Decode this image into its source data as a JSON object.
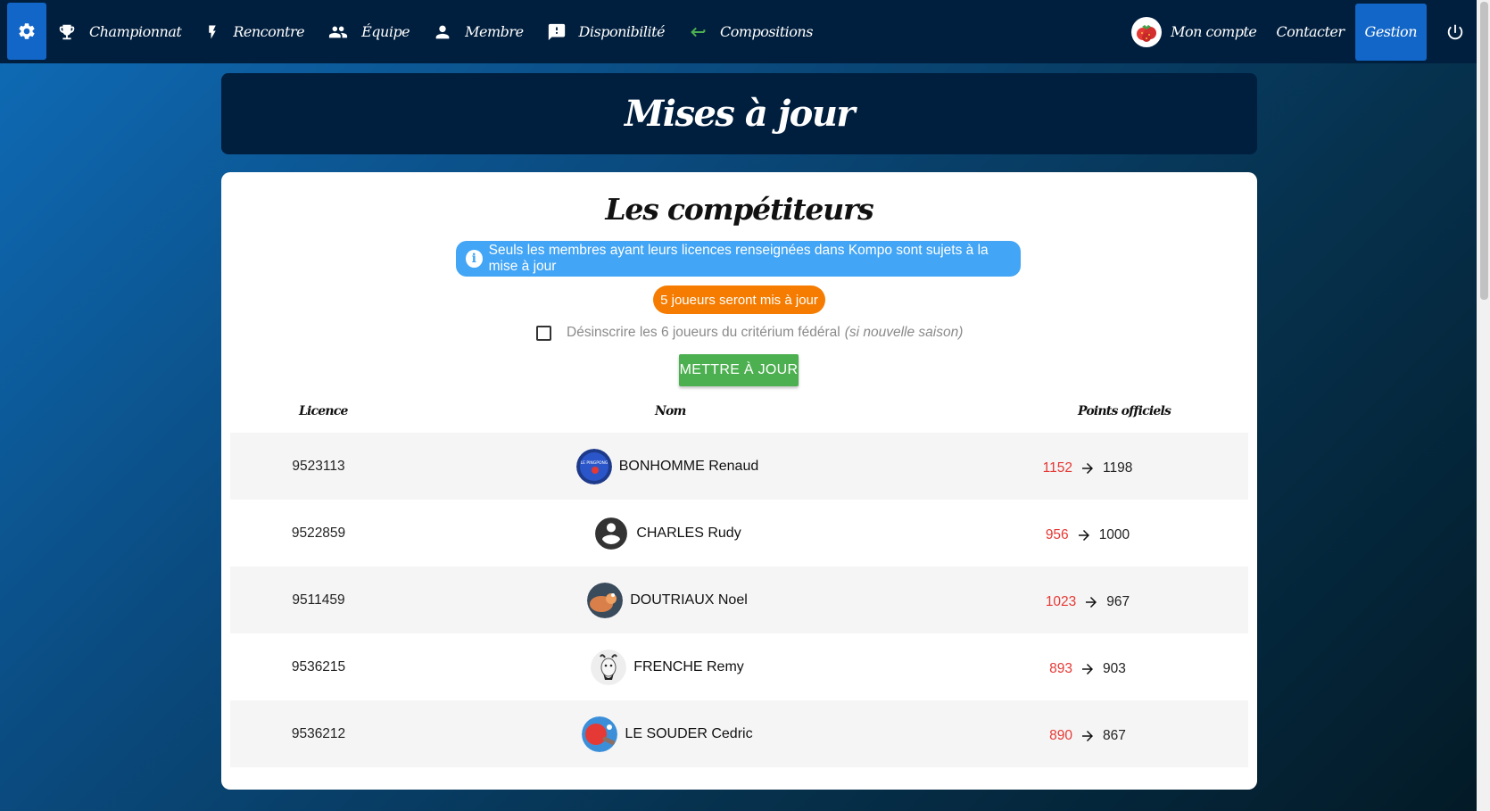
{
  "nav": {
    "left": [
      {
        "label": "Championnat",
        "icon": "trophy-icon"
      },
      {
        "label": "Rencontre",
        "icon": "lightning-icon"
      },
      {
        "label": "Équipe",
        "icon": "group-icon"
      },
      {
        "label": "Membre",
        "icon": "person-icon"
      },
      {
        "label": "Disponibilité",
        "icon": "feedback-icon"
      },
      {
        "label": "Compositions",
        "icon": "arrow-back-icon"
      }
    ],
    "right": {
      "account": "Mon compte",
      "contact": "Contacter",
      "gestion": "Gestion"
    }
  },
  "page_title": "Mises à jour",
  "section_title": "Les compétiteurs",
  "info_message": "Seuls les membres ayant leurs licences renseignées dans Kompo sont sujets à la mise à jour",
  "players_count_badge": "5 joueurs seront mis à jour",
  "checkbox": {
    "label": "Désinscrire les 6 joueurs du critérium fédéral",
    "note": "(si nouvelle saison)",
    "checked": false
  },
  "update_button": "METTRE À JOUR",
  "table": {
    "headers": {
      "licence": "Licence",
      "nom": "Nom",
      "points": "Points officiels"
    },
    "rows": [
      {
        "licence": "9523113",
        "nom": "BONHOMME Renaud",
        "old": "1152",
        "new": "1198",
        "avatar": "pingpong-club-avatar"
      },
      {
        "licence": "9522859",
        "nom": "CHARLES Rudy",
        "old": "956",
        "new": "1000",
        "avatar": "default-user-avatar"
      },
      {
        "licence": "9511459",
        "nom": "DOUTRIAUX Noel",
        "old": "1023",
        "new": "967",
        "avatar": "photo-avatar"
      },
      {
        "licence": "9536215",
        "nom": "FRENCHE Remy",
        "old": "893",
        "new": "903",
        "avatar": "goat-avatar"
      },
      {
        "licence": "9536212",
        "nom": "LE SOUDER Cedric",
        "old": "890",
        "new": "867",
        "avatar": "paddle-avatar"
      }
    ]
  },
  "colors": {
    "navbar": "#001e3d",
    "active": "#1266c7",
    "info": "#42a5f5",
    "warning": "#f57c00",
    "success": "#4caf50",
    "old_points": "#e53935"
  }
}
